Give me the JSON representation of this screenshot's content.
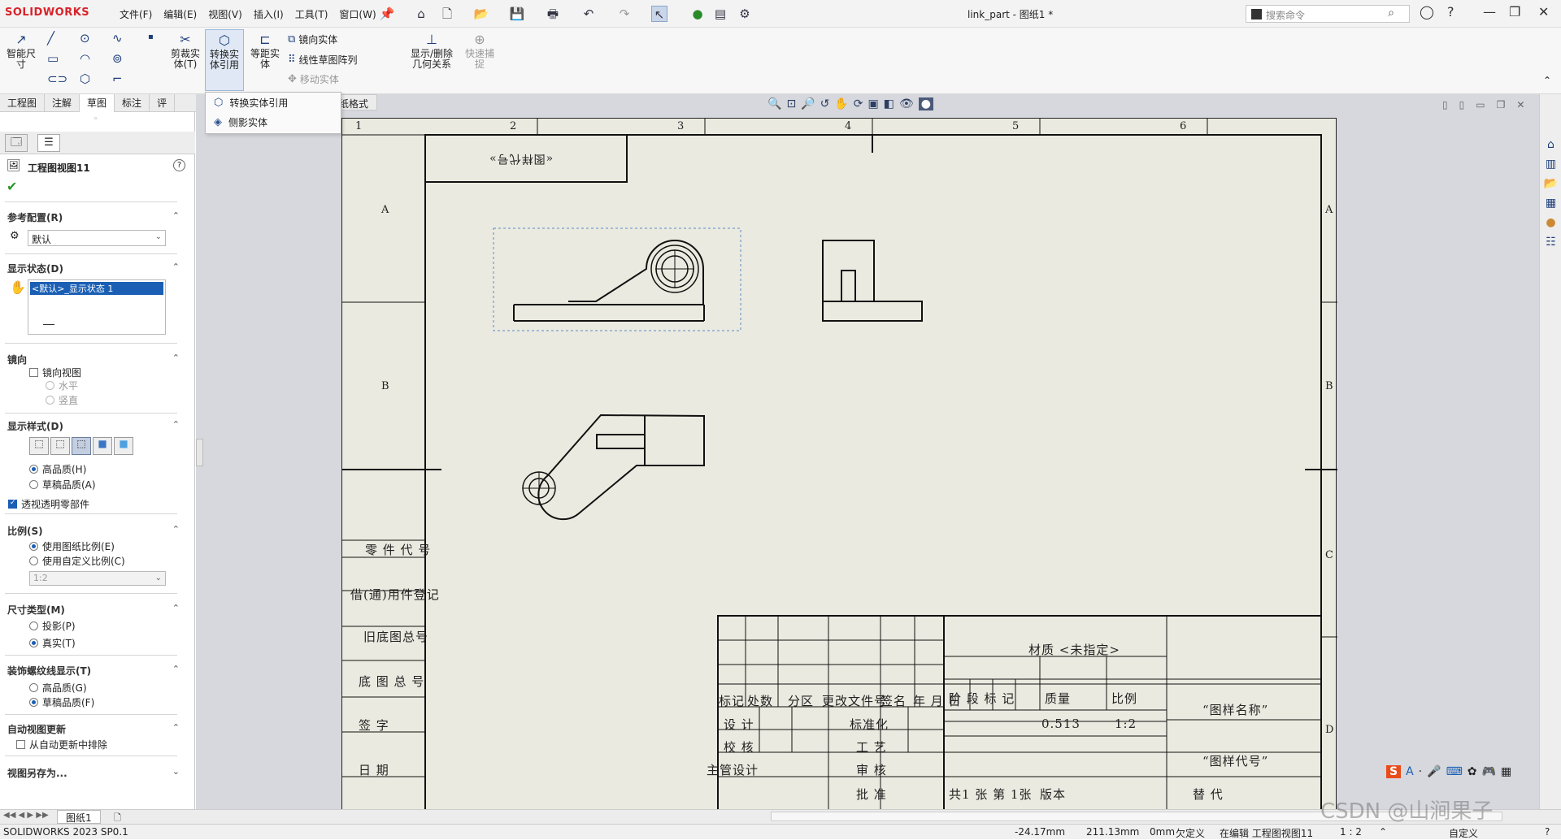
{
  "app": {
    "logo": "SOLIDWORKS",
    "menus": [
      "文件(F)",
      "编辑(E)",
      "视图(V)",
      "插入(I)",
      "工具(T)",
      "窗口(W)"
    ],
    "doc_title": "link_part - 图纸1 *",
    "search_placeholder": "搜索命令"
  },
  "ribbon": {
    "smart_dim": "智能尺寸",
    "trim": "剪裁实体(T)",
    "convert": "转换实体引用",
    "offset": "等距实体",
    "mirror": "镜向实体",
    "linear_pattern": "线性草图阵列",
    "move": "移动实体",
    "relations": "显示/删除几何关系",
    "quick_snap": "快速捕捉"
  },
  "tabs": [
    "工程图",
    "注解",
    "草图",
    "标注",
    "评"
  ],
  "active_tab": "草图",
  "dropdown": {
    "items": [
      "转换实体引用",
      "侧影实体"
    ]
  },
  "sheet_format_tab": "纸格式",
  "panel": {
    "title": "工程图视图11",
    "ref_config": {
      "label": "参考配置(R)",
      "value": "默认"
    },
    "display_state": {
      "label": "显示状态(D)",
      "selected": "<默认>_显示状态 1"
    },
    "mirror": {
      "label": "镜向",
      "checkbox": "镜向视图",
      "horizontal": "水平",
      "vertical": "竖直"
    },
    "display_style": {
      "label": "显示样式(D)",
      "high_quality": "高品质(H)",
      "draft_quality": "草稿品质(A)",
      "transparent": "透视透明零部件"
    },
    "scale": {
      "label": "比例(S)",
      "use_sheet": "使用图纸比例(E)",
      "use_custom": "使用自定义比例(C)",
      "custom_value": "1:2"
    },
    "dim_type": {
      "label": "尺寸类型(M)",
      "projected": "投影(P)",
      "true": "真实(T)"
    },
    "cosmetic_thread": {
      "label": "装饰螺纹线显示(T)",
      "high_quality": "高品质(G)",
      "draft_quality": "草稿品质(F)"
    },
    "auto_update": {
      "label": "自动视图更新",
      "exclude": "从自动更新中排除"
    },
    "save_view_as": "视图另存为..."
  },
  "drawing": {
    "column_labels": [
      "1",
      "2",
      "3",
      "4",
      "5",
      "6"
    ],
    "row_labels": [
      "A",
      "B",
      "C",
      "D"
    ],
    "mirror_title": "«图样代号»",
    "left_block": [
      "零 件 代 号",
      "借(通)用件登记",
      "旧底图总号",
      "底 图 总 号",
      "签 字",
      "日 期"
    ],
    "title_block": {
      "material": "材质 <未指定>",
      "drawing_name": "“图样名称”",
      "drawing_code": "“图样代号”",
      "headers": [
        "标记",
        "处数",
        "分区",
        "更改文件号",
        "签名",
        "年 月 日"
      ],
      "stage": "阶 段 标 记",
      "mass_label": "质量",
      "scale_label": "比例",
      "mass": "0.513",
      "scale": "1:2",
      "design": "设 计",
      "standard": "标准化",
      "check": "校 核",
      "process": "工 艺",
      "chief": "主管设计",
      "review": "审 核",
      "approve": "批 准",
      "sheets": "共1 张 第 1张",
      "version": "版本",
      "replace": "替 代"
    }
  },
  "sheet_tab": "图纸1",
  "status": {
    "version": "SOLIDWORKS 2023 SP0.1",
    "x": "-24.17mm",
    "y": "211.13mm",
    "z": "0mm",
    "defined": "欠定义",
    "editing": "在编辑 工程图视图11",
    "scale": "1 : 2",
    "custom": "自定义"
  },
  "watermark": "CSDN @山涧果子"
}
